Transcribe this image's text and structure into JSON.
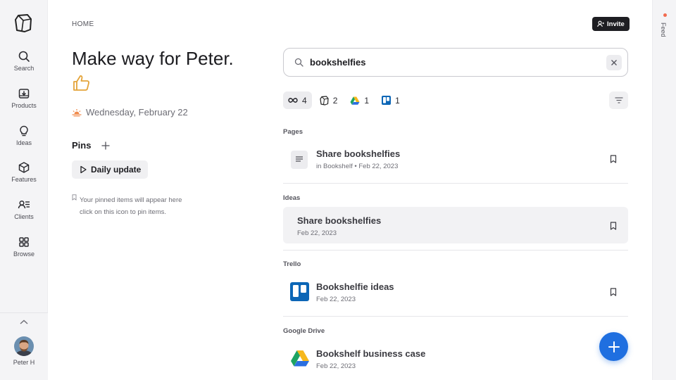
{
  "sidebar": {
    "items": [
      {
        "label": "Search",
        "icon": "search-icon"
      },
      {
        "label": "Products",
        "icon": "inbox-download-icon"
      },
      {
        "label": "Ideas",
        "icon": "lightbulb-icon"
      },
      {
        "label": "Features",
        "icon": "cube-icon"
      },
      {
        "label": "Clients",
        "icon": "clients-icon"
      },
      {
        "label": "Browse",
        "icon": "grid-icon"
      }
    ],
    "user": {
      "name": "Peter H"
    }
  },
  "rail": {
    "feed_label": "Feed"
  },
  "header": {
    "breadcrumb": "HOME",
    "invite_label": "Invite"
  },
  "welcome": {
    "headline": "Make way for Peter.",
    "date": "Wednesday, February 22"
  },
  "pins": {
    "title": "Pins",
    "daily_update_label": "Daily update",
    "hint_line1": "Your pinned items will appear here",
    "hint_line2": "click on this icon to pin items."
  },
  "search": {
    "value": "bookshelfies",
    "placeholder": ""
  },
  "filters": [
    {
      "icon": "infinity-icon",
      "count": "4",
      "active": true
    },
    {
      "icon": "workspace-logo-icon",
      "count": "2",
      "active": false
    },
    {
      "icon": "google-drive-icon",
      "count": "1",
      "active": false
    },
    {
      "icon": "trello-icon",
      "count": "1",
      "active": false
    }
  ],
  "results": {
    "pages_label": "Pages",
    "ideas_label": "Ideas",
    "trello_label": "Trello",
    "drive_label": "Google Drive",
    "page_item": {
      "title": "Share bookshelfies",
      "meta": "in Bookshelf • Feb 22, 2023"
    },
    "idea_item": {
      "title": "Share bookshelfies",
      "meta": "Feb 22, 2023"
    },
    "trello_item": {
      "title": "Bookshelfie ideas",
      "meta": "Feb 22, 2023"
    },
    "drive_item": {
      "title": "Bookshelf business case",
      "meta": "Feb 22, 2023"
    }
  },
  "colors": {
    "accent": "#1f6fe0",
    "sidebar_bg": "#f4f4f6",
    "trello_blue": "#0c66b6",
    "notification": "#f26b4f"
  }
}
